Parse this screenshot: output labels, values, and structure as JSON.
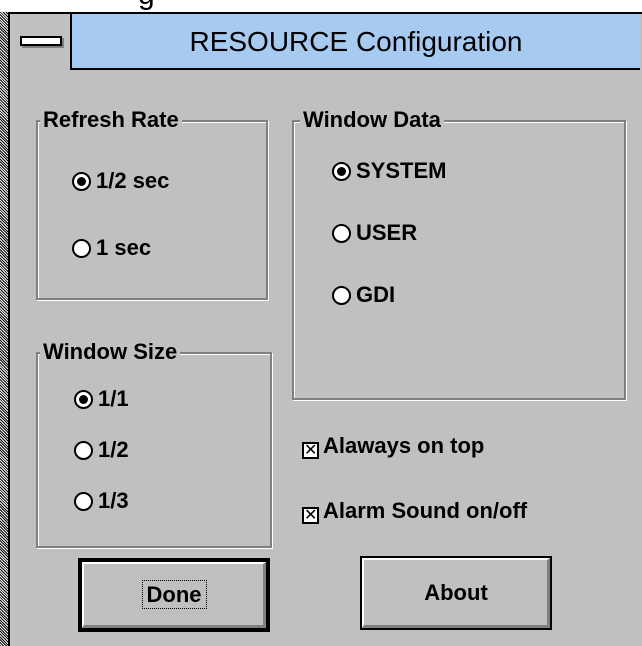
{
  "window": {
    "title": "RESOURCE Configuration",
    "above_text": "g"
  },
  "refresh_rate": {
    "label": "Refresh Rate",
    "options": [
      {
        "label": "1/2 sec",
        "selected": true
      },
      {
        "label": "1 sec",
        "selected": false
      }
    ]
  },
  "window_data": {
    "label": "Window Data",
    "options": [
      {
        "label": "SYSTEM",
        "selected": true
      },
      {
        "label": "USER",
        "selected": false
      },
      {
        "label": "GDI",
        "selected": false
      }
    ]
  },
  "window_size": {
    "label": "Window Size",
    "options": [
      {
        "label": "1/1",
        "selected": true
      },
      {
        "label": "1/2",
        "selected": false
      },
      {
        "label": "1/3",
        "selected": false
      }
    ]
  },
  "checkboxes": [
    {
      "label": "Alaways on top",
      "checked": true
    },
    {
      "label": "Alarm Sound on/off",
      "checked": true
    }
  ],
  "buttons": {
    "done": "Done",
    "about": "About"
  },
  "colors": {
    "titlebar": "#a6caf0",
    "face": "#c0c0c0"
  }
}
